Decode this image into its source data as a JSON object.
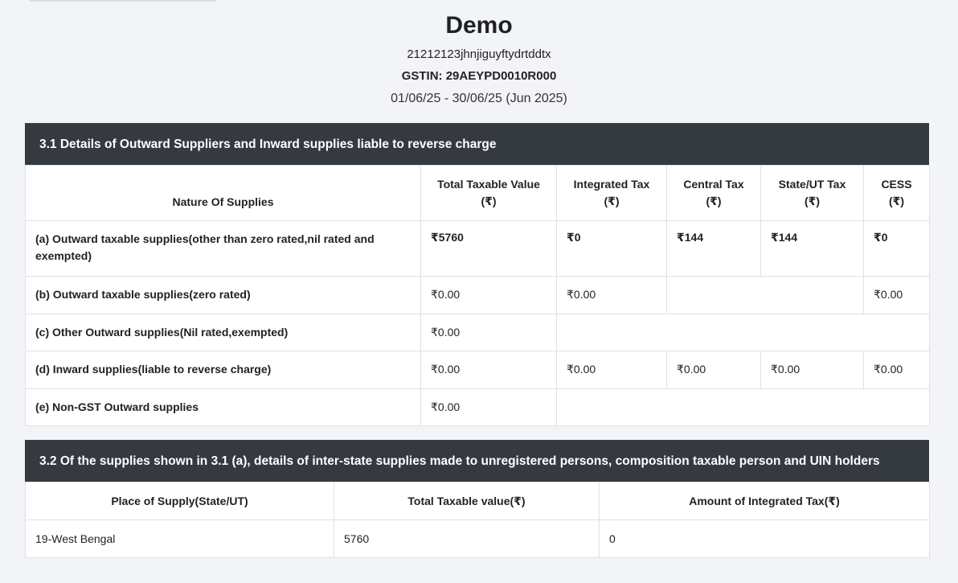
{
  "header": {
    "company": "Demo",
    "address": "21212123jhnjiguyftydrtddtx",
    "gstin": "GSTIN: 29AEYPD0010R000",
    "period": "01/06/25 - 30/06/25 (Jun 2025)"
  },
  "section31": {
    "title": "3.1 Details of Outward Suppliers and Inward supplies liable to reverse charge",
    "headers": {
      "nature": "Nature Of Supplies",
      "taxable": "Total Taxable Value",
      "igst": "Integrated Tax",
      "cgst": "Central Tax",
      "sgst": "State/UT Tax",
      "cess": "CESS",
      "unit": "(₹)"
    },
    "rows": {
      "a": {
        "label": "(a) Outward taxable supplies(other than zero rated,nil rated and exempted)",
        "taxable": "₹5760",
        "igst": "₹0",
        "cgst": "₹144",
        "sgst": "₹144",
        "cess": "₹0"
      },
      "b": {
        "label": "(b) Outward taxable supplies(zero rated)",
        "taxable": "₹0.00",
        "igst": "₹0.00",
        "cess": "₹0.00"
      },
      "c": {
        "label": "(c) Other Outward supplies(Nil rated,exempted)",
        "taxable": "₹0.00"
      },
      "d": {
        "label": "(d) Inward supplies(liable to reverse charge)",
        "taxable": "₹0.00",
        "igst": "₹0.00",
        "cgst": "₹0.00",
        "sgst": "₹0.00",
        "cess": "₹0.00"
      },
      "e": {
        "label": "(e) Non-GST Outward supplies",
        "taxable": "₹0.00"
      }
    }
  },
  "section32": {
    "title": "3.2 Of the supplies shown in 3.1 (a), details of inter-state supplies made to unregistered persons, composition taxable person and UIN holders",
    "headers": {
      "place": "Place of Supply(State/UT)",
      "taxable": "Total Taxable value(₹)",
      "igst": "Amount of Integrated Tax(₹)"
    },
    "rows": [
      {
        "place": "19-West Bengal",
        "taxable": "5760",
        "igst": "0"
      }
    ]
  }
}
